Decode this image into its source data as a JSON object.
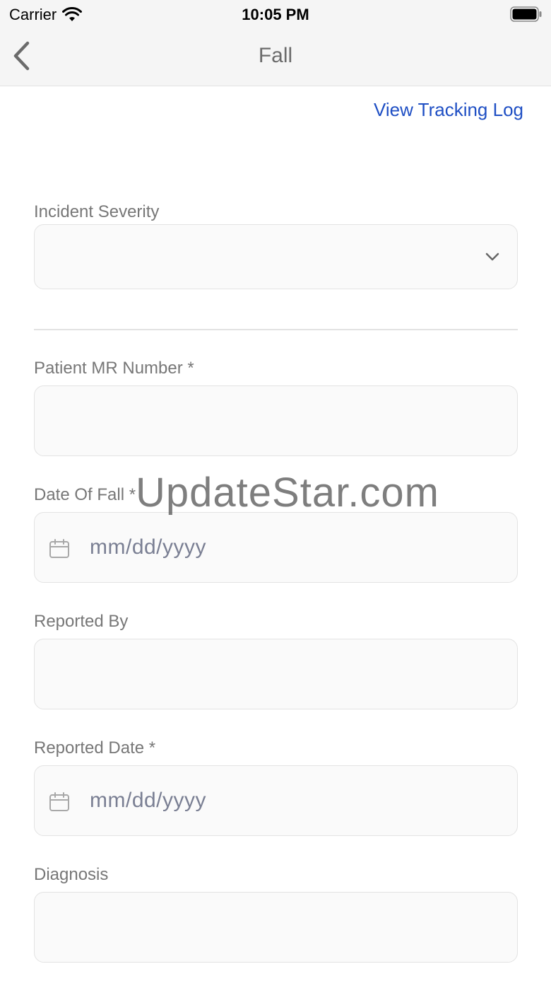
{
  "status_bar": {
    "carrier": "Carrier",
    "time": "10:05 PM",
    "wifi_icon": "wifi-icon",
    "battery_icon": "battery-icon"
  },
  "nav": {
    "title": "Fall",
    "back_icon": "chevron-left-icon"
  },
  "tracking_link": "View Tracking Log",
  "form": {
    "incident_severity": {
      "label": "Incident Severity",
      "value": ""
    },
    "patient_mr_number": {
      "label": "Patient MR Number *",
      "value": ""
    },
    "date_of_fall": {
      "label": "Date Of Fall *",
      "placeholder": "mm/dd/yyyy"
    },
    "reported_by": {
      "label": "Reported By",
      "value": ""
    },
    "reported_date": {
      "label": "Reported Date *",
      "placeholder": "mm/dd/yyyy"
    },
    "diagnosis": {
      "label": "Diagnosis",
      "value": ""
    }
  },
  "watermark": "UpdateStar.com",
  "colors": {
    "link": "#1f4fc4",
    "label": "#777777",
    "field_bg": "#fafafa",
    "field_border": "#e3e3e3",
    "bar_bg": "#f5f5f5"
  }
}
